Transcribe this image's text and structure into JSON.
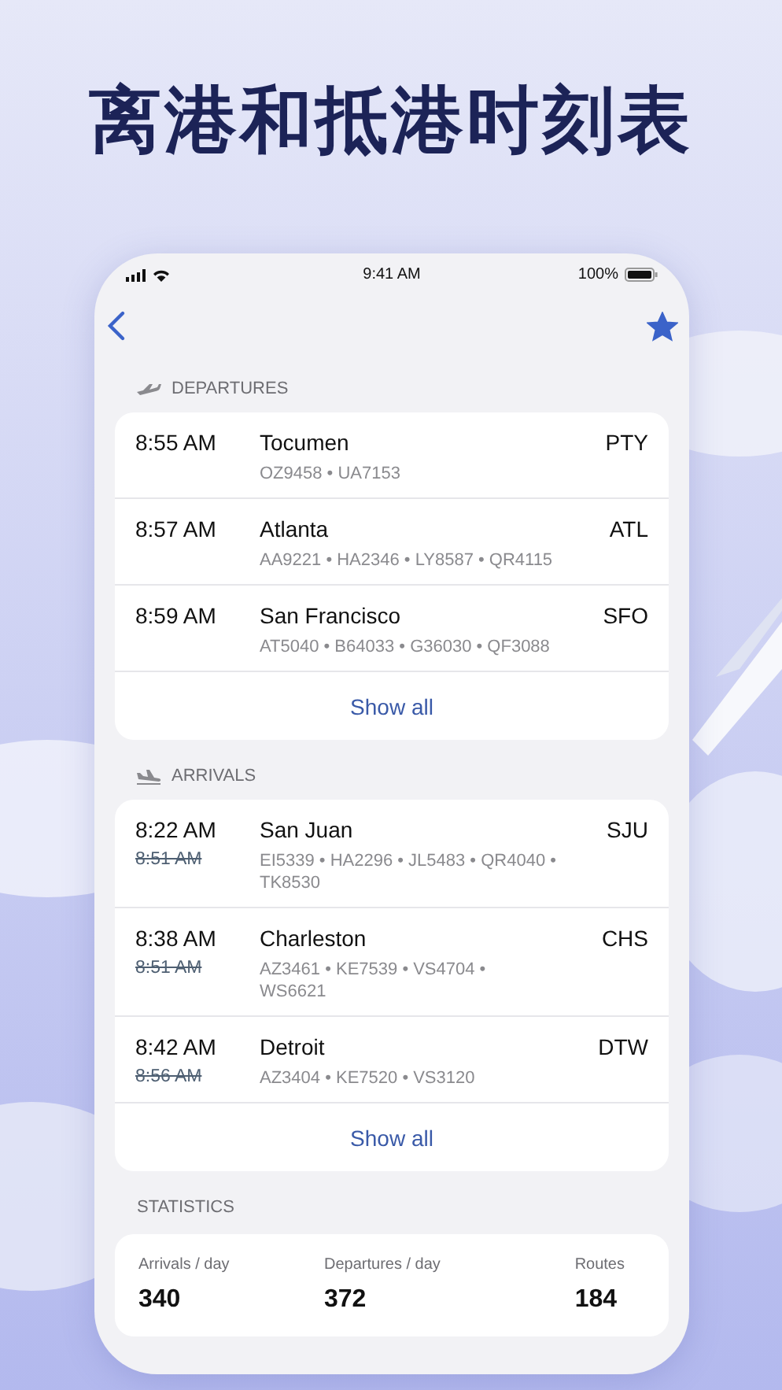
{
  "headline": "离港和抵港时刻表",
  "status_bar": {
    "time": "9:41 AM",
    "battery": "100%"
  },
  "nav": {
    "favorite": true
  },
  "departures": {
    "title": "DEPARTURES",
    "kind": "departure",
    "show_all": "Show all",
    "flights": [
      {
        "time": "8:55 AM",
        "city": "Tocumen",
        "code": "PTY",
        "flight_numbers": "OZ9458 • UA7153"
      },
      {
        "time": "8:57 AM",
        "city": "Atlanta",
        "code": "ATL",
        "flight_numbers": "AA9221 • HA2346 • LY8587 • QR4115"
      },
      {
        "time": "8:59 AM",
        "city": "San Francisco",
        "code": "SFO",
        "flight_numbers": "AT5040 • B64033 • G36030 • QF3088"
      }
    ]
  },
  "arrivals": {
    "title": "ARRIVALS",
    "kind": "arrival",
    "show_all": "Show all",
    "flights": [
      {
        "time": "8:22 AM",
        "scheduled_time": "8:51 AM",
        "city": "San Juan",
        "code": "SJU",
        "flight_numbers": "EI5339 • HA2296 • JL5483 • QR4040 • TK8530"
      },
      {
        "time": "8:38 AM",
        "scheduled_time": "8:51 AM",
        "city": "Charleston",
        "code": "CHS",
        "flight_numbers": "AZ3461 • KE7539 • VS4704 • WS6621"
      },
      {
        "time": "8:42 AM",
        "scheduled_time": "8:56 AM",
        "city": "Detroit",
        "code": "DTW",
        "flight_numbers": "AZ3404 • KE7520 • VS3120"
      }
    ]
  },
  "statistics": {
    "title": "STATISTICS",
    "items": [
      {
        "label": "Arrivals / day",
        "value": "340"
      },
      {
        "label": "Departures / day",
        "value": "372"
      },
      {
        "label": "Routes",
        "value": "184"
      }
    ]
  }
}
